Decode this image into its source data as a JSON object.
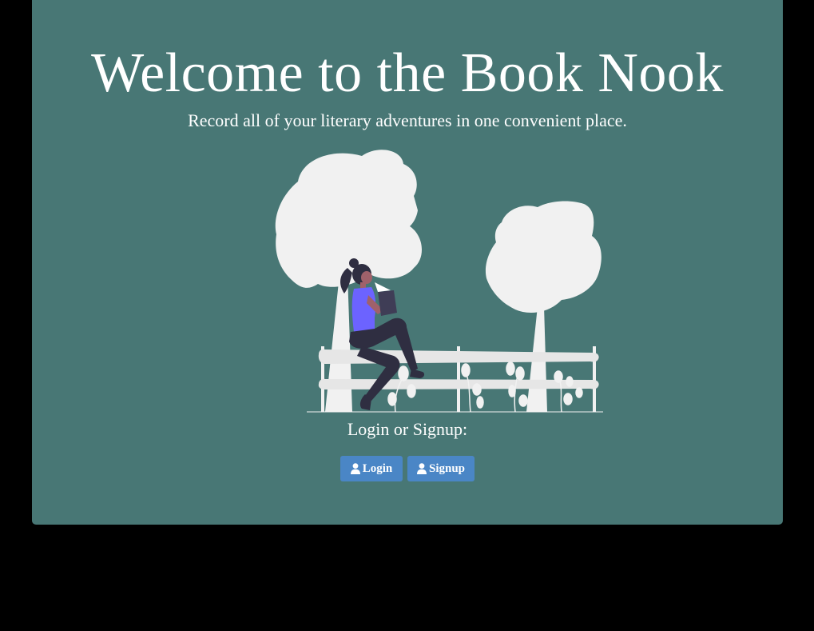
{
  "hero": {
    "title": "Welcome to the Book Nook",
    "subtitle": "Record all of your literary adventures in one convenient place."
  },
  "auth": {
    "heading": "Login or Signup:",
    "login_label": "Login",
    "signup_label": "Signup",
    "login_icon": "user-icon",
    "signup_icon": "user-icon"
  },
  "illustration": {
    "name": "woman-reading-on-fence"
  },
  "colors": {
    "page_background": "#000000",
    "card_background": "#487775",
    "button_background": "#4a86c6",
    "tree_fill": "#f1f1f1",
    "shirt": "#6c63ff",
    "pants": "#2f2e41"
  }
}
